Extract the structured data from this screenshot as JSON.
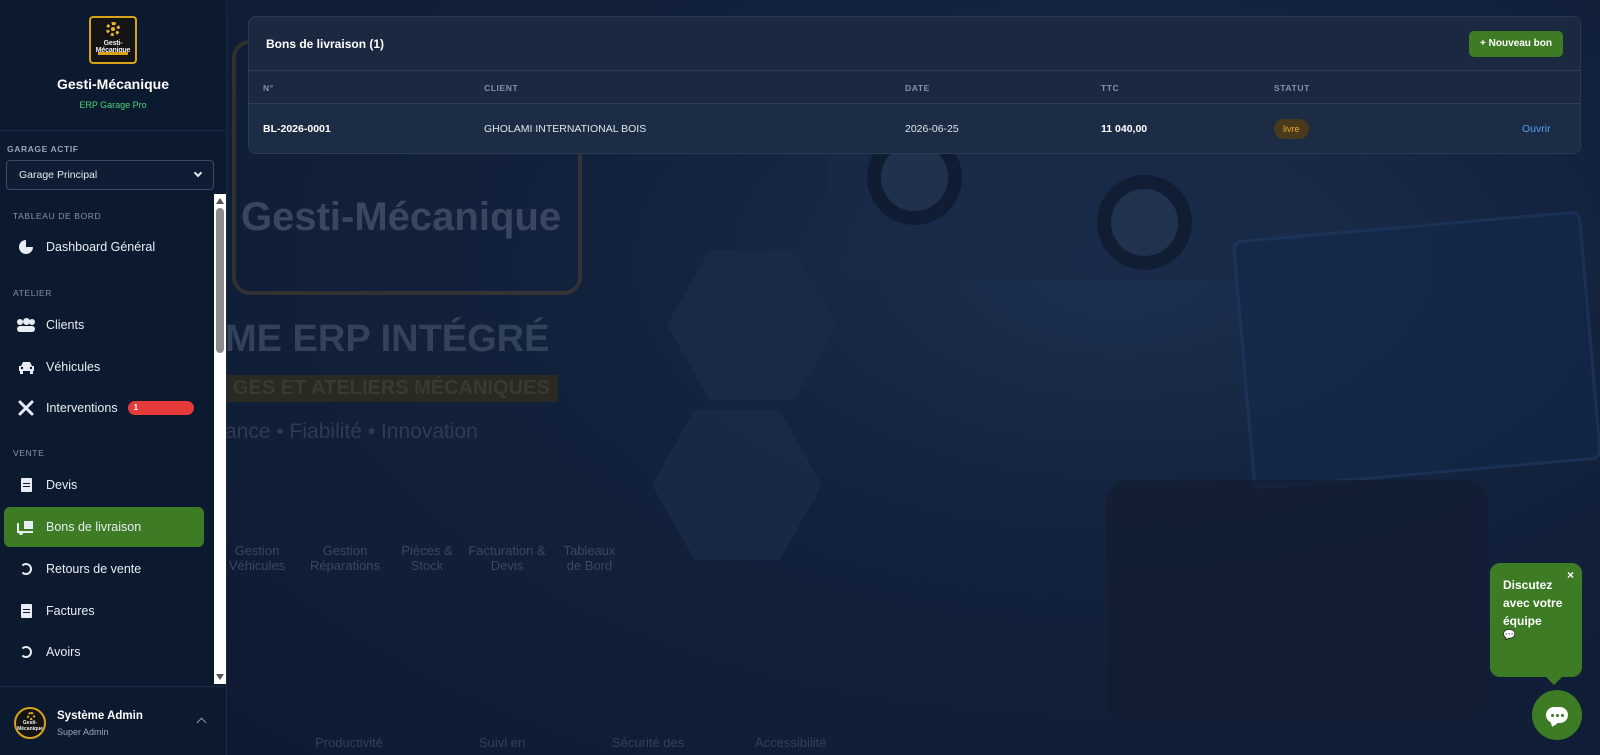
{
  "brand": {
    "name": "Gesti-Mécanique",
    "subtitle": "ERP Garage Pro",
    "logo_text": "Gesti-Mécanique"
  },
  "garage": {
    "label": "GARAGE ACTIF",
    "selected": "Garage Principal"
  },
  "nav": {
    "sections": {
      "dashboard": "TABLEAU DE BORD",
      "atelier": "ATELIER",
      "vente": "VENTE"
    },
    "items": [
      {
        "label": "Dashboard Général",
        "icon": "chart-pie-icon"
      },
      {
        "label": "Clients",
        "icon": "users-icon"
      },
      {
        "label": "Véhicules",
        "icon": "car-icon"
      },
      {
        "label": "Interventions",
        "icon": "tools-icon",
        "badge": "1"
      },
      {
        "label": "Devis",
        "icon": "document-icon"
      },
      {
        "label": "Bons de livraison",
        "icon": "truck-loading-icon",
        "active": true
      },
      {
        "label": "Retours de vente",
        "icon": "undo-icon"
      },
      {
        "label": "Factures",
        "icon": "invoice-icon"
      },
      {
        "label": "Avoirs",
        "icon": "undo-icon"
      }
    ]
  },
  "profile": {
    "name": "Système Admin",
    "role": "Super Admin"
  },
  "background": {
    "brand": "Gesti-Mécanique",
    "erp": "ME ERP INTÉGRÉ",
    "garages": "GES ET ATELIERS MÉCANIQUES",
    "tagline": "ance • Fiabilité • Innovation",
    "features": [
      "Gestion Véhicules",
      "Gestion Réparations",
      "Pièces & Stock",
      "Facturation & Devis",
      "Tableaux de Bord"
    ],
    "footer": [
      "Productivité",
      "Suivi en",
      "Sécurité des",
      "Accessibilité"
    ]
  },
  "panel": {
    "title": "Bons de livraison (1)",
    "new_button": "+ Nouveau bon",
    "columns": {
      "num": "N°",
      "client": "CLIENT",
      "date": "DATE",
      "ttc": "TTC",
      "status": "STATUT"
    },
    "rows": [
      {
        "num": "BL-2026-0001",
        "client": "GHOLAMI INTERNATIONAL BOIS",
        "date": "2026-06-25",
        "ttc": "11 040,00",
        "status": "livre",
        "action": "Ouvrir"
      }
    ]
  },
  "chat": {
    "message": "Discutez avec votre équipe",
    "emoji": "💬",
    "close": "×"
  },
  "colors": {
    "accent": "#3d7b24",
    "sidebar_bg": "#0c1a2f",
    "status_text": "#f0a428",
    "link": "#4d9ef5",
    "badge": "#e53a3a"
  }
}
